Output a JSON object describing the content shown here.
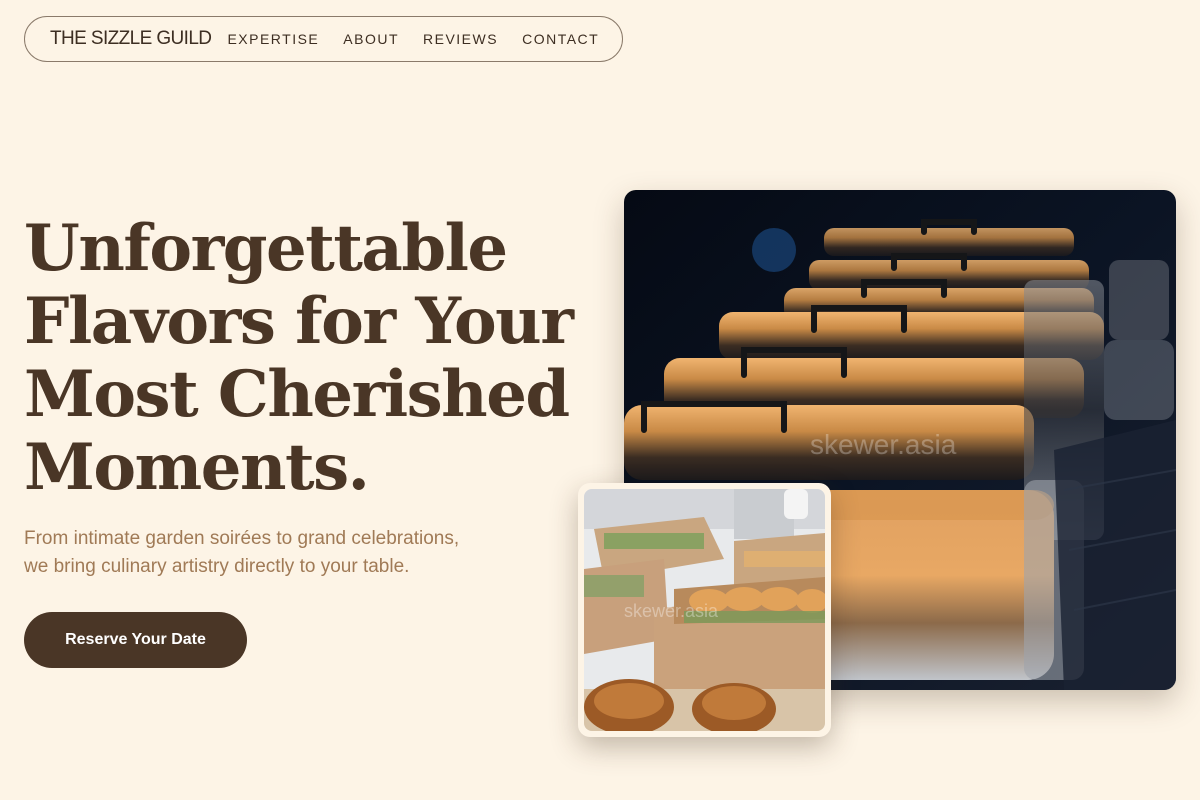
{
  "brand": {
    "name": "THE SIZZLE GUILD"
  },
  "nav": {
    "items": [
      {
        "label": "EXPERTISE"
      },
      {
        "label": "ABOUT"
      },
      {
        "label": "REVIEWS"
      },
      {
        "label": "CONTACT"
      }
    ]
  },
  "hero": {
    "headline_lines": [
      "Unforgettable",
      "Flavors for Your",
      "Most Cherished",
      "Moments."
    ],
    "subtext_lines": [
      "From intimate garden soirées to grand celebrations,",
      "we bring culinary artistry directly to your table."
    ],
    "cta_label": "Reserve Your Date"
  },
  "images": {
    "main_watermark": "skewer.asia",
    "inset_watermark": "skewer.asia"
  },
  "colors": {
    "background": "#fdf4e6",
    "headline": "#4a3626",
    "subtext": "#a07a56",
    "button": "#4a3626",
    "button_text": "#ffffff"
  }
}
